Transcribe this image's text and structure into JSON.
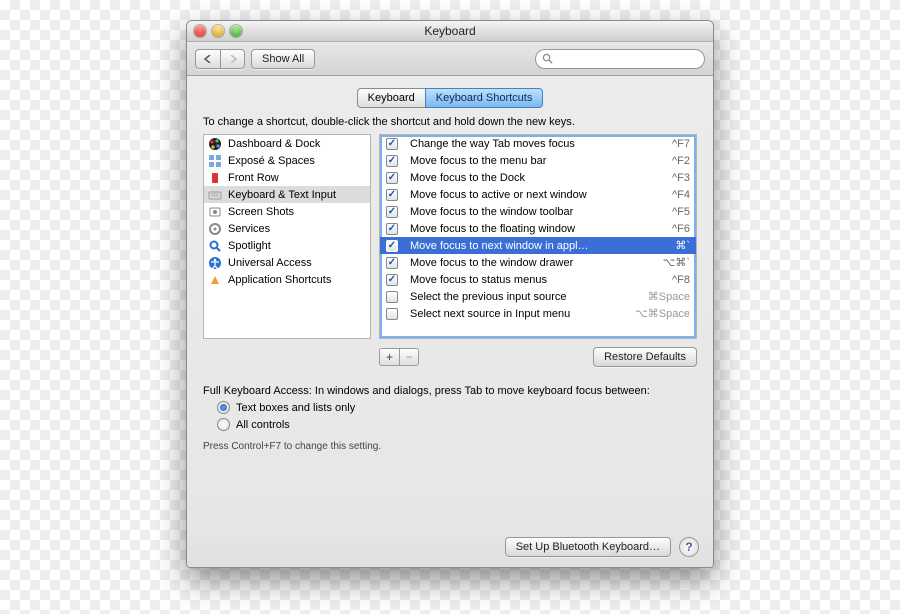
{
  "window": {
    "title": "Keyboard"
  },
  "toolbar": {
    "show_all": "Show All",
    "search_placeholder": ""
  },
  "tabs": {
    "keyboard": "Keyboard",
    "shortcuts": "Keyboard Shortcuts"
  },
  "instruction": "To change a shortcut, double-click the shortcut and hold down the new keys.",
  "categories": [
    {
      "label": "Dashboard & Dock",
      "icon": "dashboard"
    },
    {
      "label": "Exposé & Spaces",
      "icon": "expose"
    },
    {
      "label": "Front Row",
      "icon": "frontrow"
    },
    {
      "label": "Keyboard & Text Input",
      "icon": "keyboard",
      "selected": true
    },
    {
      "label": "Screen Shots",
      "icon": "screenshot"
    },
    {
      "label": "Services",
      "icon": "services"
    },
    {
      "label": "Spotlight",
      "icon": "spotlight"
    },
    {
      "label": "Universal Access",
      "icon": "universal"
    },
    {
      "label": "Application Shortcuts",
      "icon": "apps"
    }
  ],
  "shortcuts": [
    {
      "checked": true,
      "label": "Change the way Tab moves focus",
      "key": "^F7"
    },
    {
      "checked": true,
      "label": "Move focus to the menu bar",
      "key": "^F2"
    },
    {
      "checked": true,
      "label": "Move focus to the Dock",
      "key": "^F3"
    },
    {
      "checked": true,
      "label": "Move focus to active or next window",
      "key": "^F4"
    },
    {
      "checked": true,
      "label": "Move focus to the window toolbar",
      "key": "^F5"
    },
    {
      "checked": true,
      "label": "Move focus to the floating window",
      "key": "^F6"
    },
    {
      "checked": true,
      "label": "Move focus to next window in appl…",
      "key": "⌘`",
      "selected": true
    },
    {
      "checked": true,
      "label": "Move focus to the window drawer",
      "key": "⌥⌘`"
    },
    {
      "checked": true,
      "label": "Move focus to status menus",
      "key": "^F8"
    },
    {
      "checked": false,
      "label": "Select the previous input source",
      "key": "⌘Space",
      "dim": true
    },
    {
      "checked": false,
      "label": "Select next source in Input menu",
      "key": "⌥⌘Space",
      "dim": true
    }
  ],
  "restore_defaults": "Restore Defaults",
  "fka": {
    "prompt": "Full Keyboard Access: In windows and dialogs, press Tab to move keyboard focus between:",
    "opt1": "Text boxes and lists only",
    "opt2": "All controls",
    "hint": "Press Control+F7 to change this setting."
  },
  "footer": {
    "bluetooth": "Set Up Bluetooth Keyboard…"
  }
}
